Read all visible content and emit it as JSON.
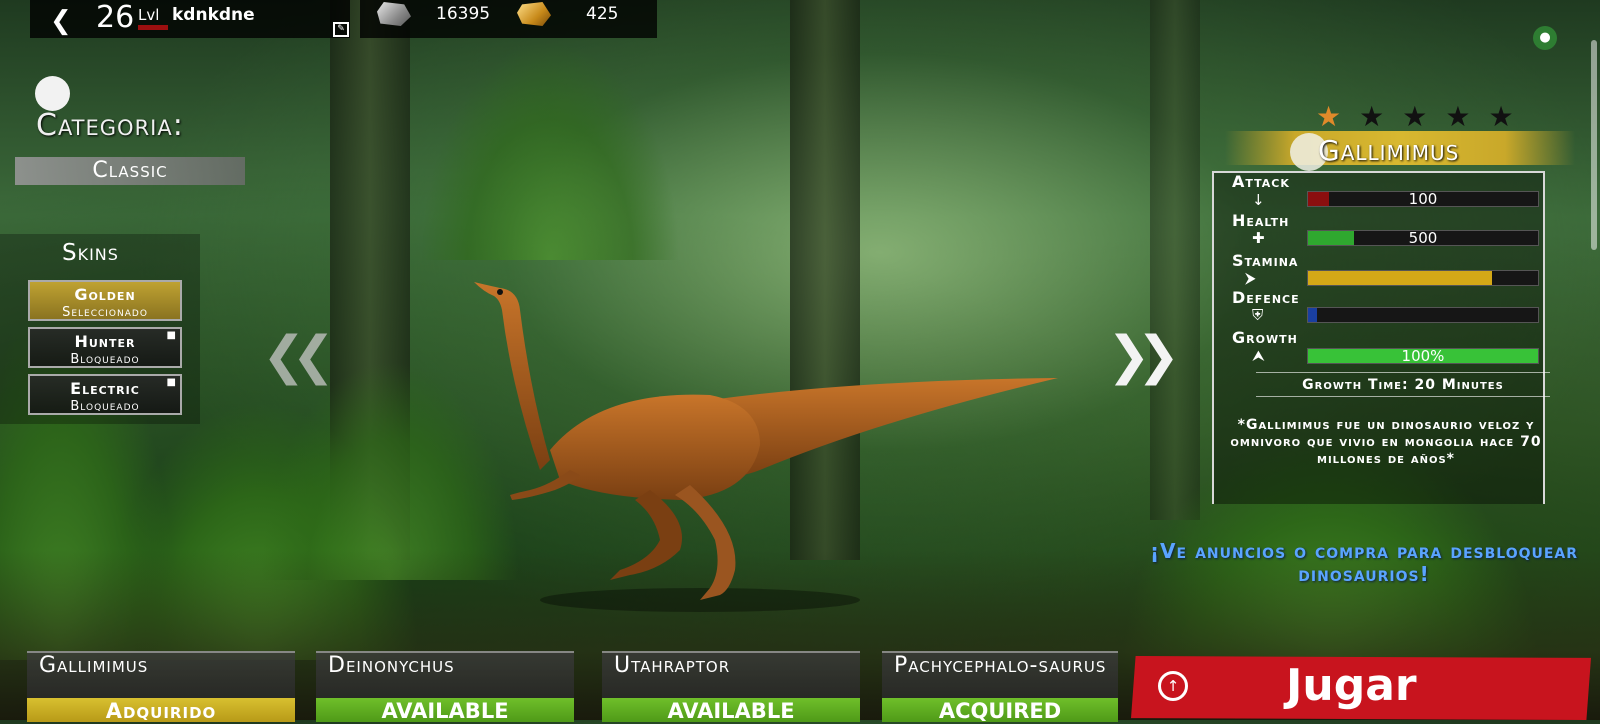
{
  "player": {
    "level": "26",
    "level_label": "Lvl",
    "name": "kdnkdne"
  },
  "resources": {
    "stone": "16395",
    "gold": "425"
  },
  "category": {
    "title": "Categoria:",
    "value": "Classic"
  },
  "skins": {
    "title": "Skins",
    "items": [
      {
        "name": "Golden",
        "status": "Seleccionado",
        "locked": false
      },
      {
        "name": "Hunter",
        "status": "Bloqueado",
        "locked": true
      },
      {
        "name": "Electric",
        "status": "Bloqueado",
        "locked": true
      }
    ]
  },
  "dinosaur": {
    "name": "Gallimimus",
    "stars_filled": 1,
    "stars_total": 5,
    "stats": [
      {
        "label": "Attack",
        "icon": "claw-icon",
        "value_text": "100",
        "fill": 0.09,
        "color": "#8b0f0f"
      },
      {
        "label": "Health",
        "icon": "cross-icon",
        "value_text": "500",
        "fill": 0.2,
        "color": "#2fa82f"
      },
      {
        "label": "Stamina",
        "icon": "running-dino-icon",
        "value_text": "",
        "fill": 0.8,
        "color": "#d4a817"
      },
      {
        "label": "Defence",
        "icon": "shield-icon",
        "value_text": "",
        "fill": 0.04,
        "color": "#1a3fa0"
      },
      {
        "label": "Growth",
        "icon": "baby-dino-icon",
        "value_text": "100%",
        "fill": 1.0,
        "color": "#38c238"
      }
    ],
    "growth_time": "Growth Time: 20 Minutes",
    "description": "*Gallimimus fue un dinosaurio veloz y omnivoro que vivio en mongolia hace 70 millones de años*"
  },
  "promo": "¡Ve anuncios o compra para desbloquear dinosaurios!",
  "roster": [
    {
      "name": "Gallimimus",
      "status": "Adquirido",
      "state": "owned"
    },
    {
      "name": "Deinonychus",
      "status": "AVAILABLE",
      "state": "available"
    },
    {
      "name": "Utahraptor",
      "status": "AVAILABLE",
      "state": "available"
    },
    {
      "name": "Pachycephalo-saurus",
      "status": "ACQUIRED",
      "state": "available"
    }
  ],
  "play_button": "Jugar",
  "colors": {
    "gold": "#c9a82a",
    "green": "#5fae22",
    "red": "#c8141e",
    "promo_blue": "#5aa4ff"
  }
}
